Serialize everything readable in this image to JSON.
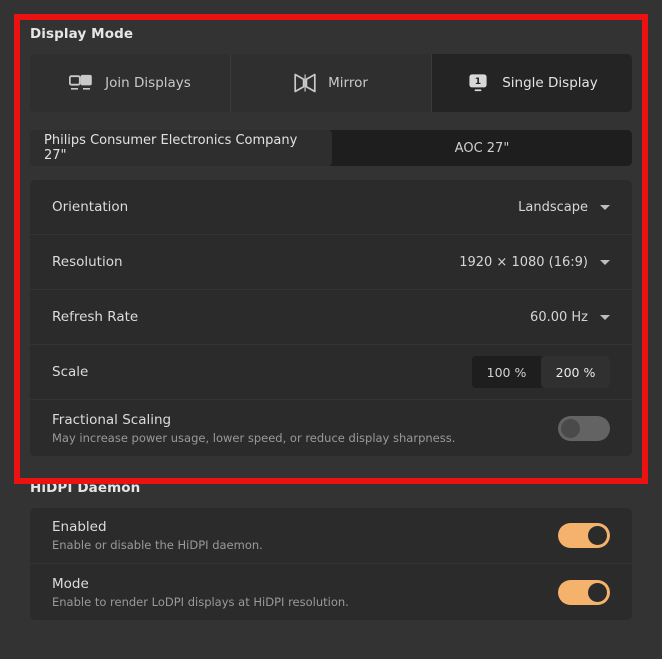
{
  "display_mode": {
    "title": "Display Mode",
    "modes": [
      {
        "label": "Join Displays",
        "icon": "two-monitors-icon",
        "selected": false
      },
      {
        "label": "Mirror",
        "icon": "mirror-bowtie-icon",
        "selected": false
      },
      {
        "label": "Single Display",
        "icon": "single-monitor-one-icon",
        "selected": true
      }
    ],
    "monitors": [
      {
        "label": "Philips Consumer Electronics Company 27\"",
        "selected": true
      },
      {
        "label": "AOC 27\"",
        "selected": false
      }
    ],
    "settings": {
      "orientation": {
        "label": "Orientation",
        "value": "Landscape"
      },
      "resolution": {
        "label": "Resolution",
        "value": "1920 × 1080 (16:9)"
      },
      "refresh_rate": {
        "label": "Refresh Rate",
        "value": "60.00 Hz"
      },
      "scale": {
        "label": "Scale",
        "options": [
          "100 %",
          "200 %"
        ],
        "selected": "200 %"
      },
      "fractional_scaling": {
        "label": "Fractional Scaling",
        "description": "May increase power usage, lower speed, or reduce display sharpness.",
        "state": "off"
      }
    }
  },
  "hidpi_daemon": {
    "title": "HiDPI Daemon",
    "rows": [
      {
        "label": "Enabled",
        "description": "Enable or disable the HiDPI daemon.",
        "state": "on"
      },
      {
        "label": "Mode",
        "description": "Enable to render LoDPI displays at HiDPI resolution.",
        "state": "on"
      }
    ]
  },
  "colors": {
    "accent_toggle_on": "#f4b26c",
    "annotation": "#ee1111",
    "page_bg": "#333333",
    "card_bg": "#2b2b2b"
  }
}
